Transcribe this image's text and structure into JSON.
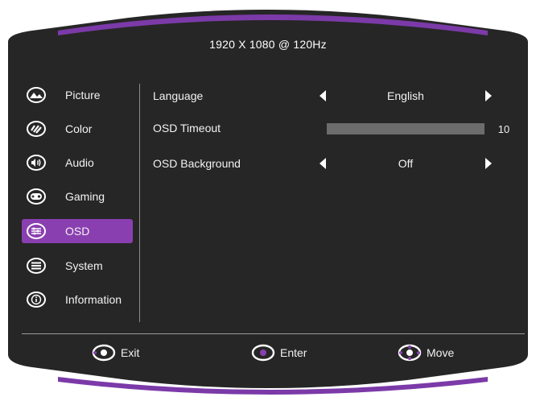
{
  "resolution_title": "1920 X 1080 @ 120Hz",
  "menu": [
    {
      "label": "Picture",
      "icon": "picture-icon",
      "active": false
    },
    {
      "label": "Color",
      "icon": "color-icon",
      "active": false
    },
    {
      "label": "Audio",
      "icon": "audio-icon",
      "active": false
    },
    {
      "label": "Gaming",
      "icon": "gaming-icon",
      "active": false
    },
    {
      "label": "OSD",
      "icon": "osd-icon",
      "active": true
    },
    {
      "label": "System",
      "icon": "system-icon",
      "active": false
    },
    {
      "label": "Information",
      "icon": "information-icon",
      "active": false
    }
  ],
  "settings": {
    "language": {
      "label": "Language",
      "value": "English"
    },
    "osd_timeout": {
      "label": "OSD Timeout",
      "value": "10",
      "level": 1.0
    },
    "osd_background": {
      "label": "OSD Background",
      "value": "Off"
    }
  },
  "footer": {
    "exit": "Exit",
    "enter": "Enter",
    "move": "Move"
  },
  "colors": {
    "panel": "#262626",
    "accent": "#8a3fb0",
    "bezel_trim": "#7b3aa8"
  }
}
